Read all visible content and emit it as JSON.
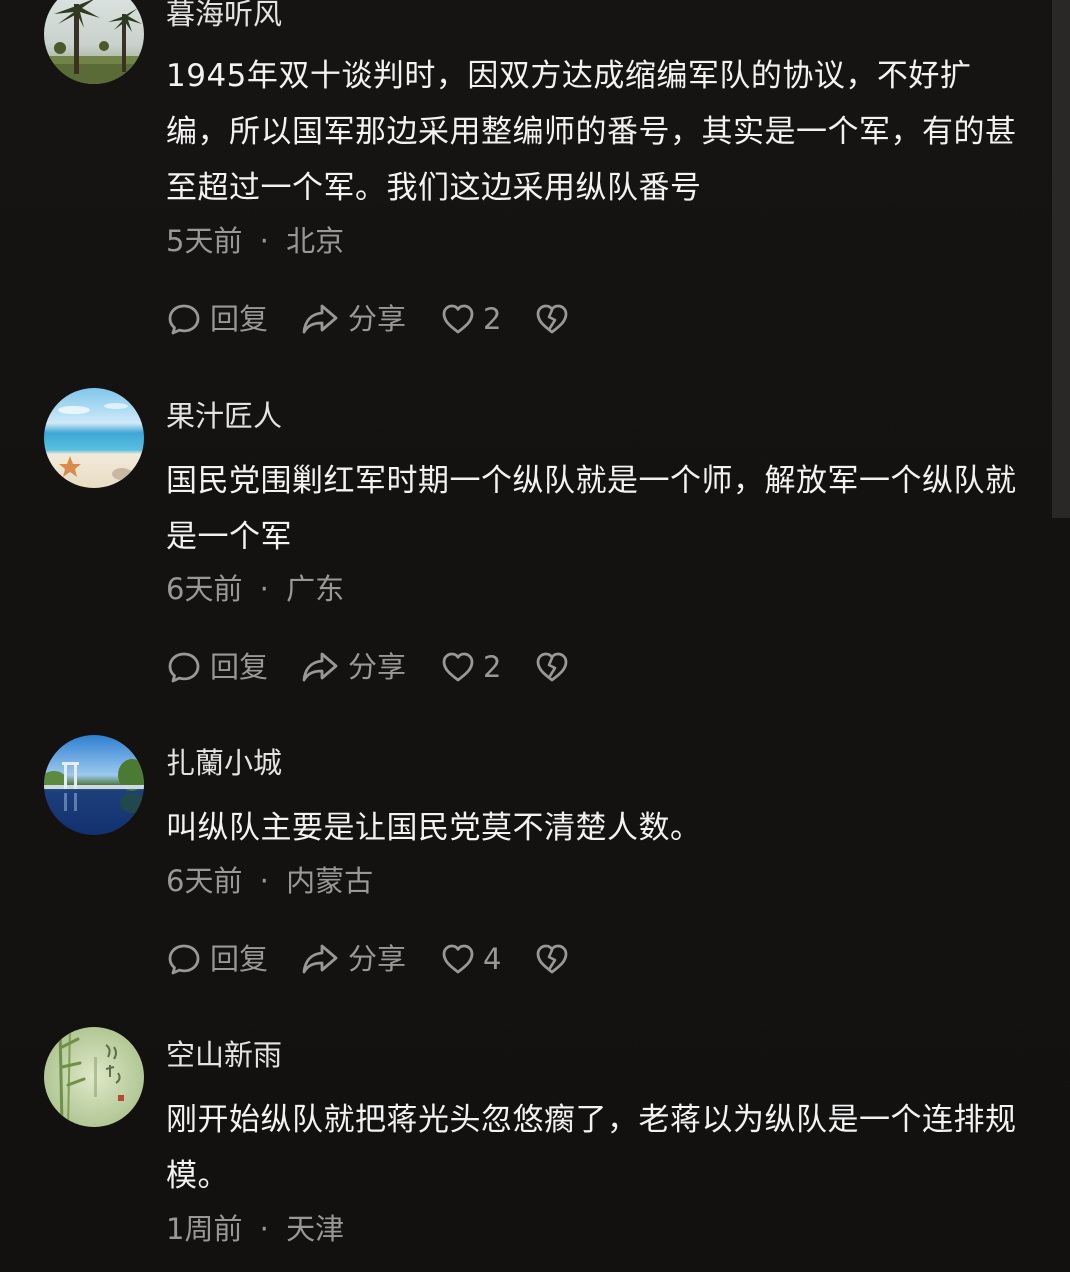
{
  "actions": {
    "reply": "回复",
    "share": "分享"
  },
  "comments": [
    {
      "username": "暮海听风",
      "text": "1945年双十谈判时，因双方达成缩编军队的协议，不好扩编，所以国军那边采用整编师的番号，其实是一个军，有的甚至超过一个军。我们这边采用纵队番号",
      "time": "5天前",
      "location": "北京",
      "likes": "2",
      "avatar": "palm-trees"
    },
    {
      "username": "果汁匠人",
      "text": "国民党围剿红军时期一个纵队就是一个师，解放军一个纵队就是一个军",
      "time": "6天前",
      "location": "广东",
      "likes": "2",
      "avatar": "beach-starfish"
    },
    {
      "username": "扎蘭小城",
      "text": "叫纵队主要是让国民党莫不清楚人数。",
      "time": "6天前",
      "location": "内蒙古",
      "likes": "4",
      "avatar": "lake-bridge"
    },
    {
      "username": "空山新雨",
      "text": "刚开始纵队就把蒋光头忽悠瘸了，老蒋以为纵队是一个连排规模。",
      "time": "1周前",
      "location": "天津",
      "avatar": "bamboo-calligraphy"
    }
  ],
  "meta_separator": "·",
  "colors": {
    "background": "#141210",
    "text": "#f2f2f2",
    "muted": "#9a9896"
  }
}
